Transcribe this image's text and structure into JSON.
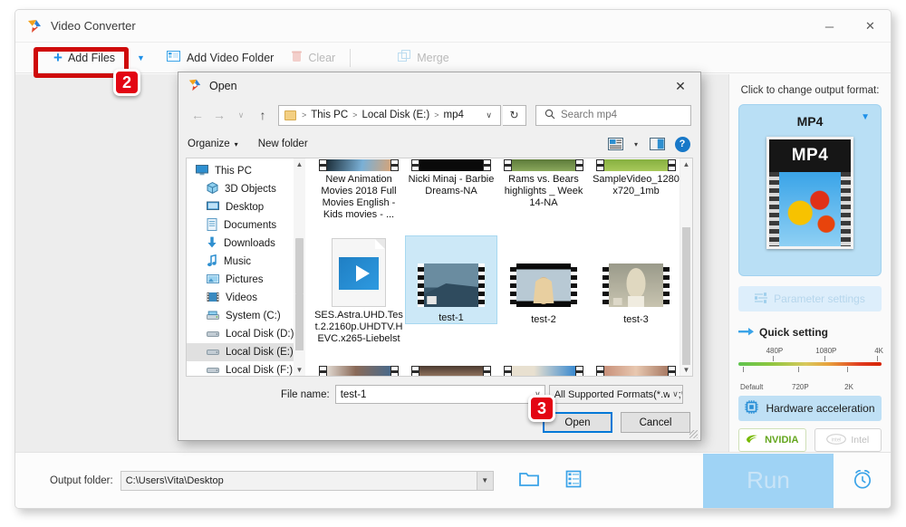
{
  "app": {
    "title": "Video Converter",
    "window_buttons": [
      {
        "name": "minimize",
        "glyph": "─"
      },
      {
        "name": "close",
        "glyph": "✕"
      }
    ],
    "toolbar": {
      "add_files": "Add Files",
      "add_files_caret": "▼",
      "add_video_folder": "Add Video Folder",
      "clear": "Clear",
      "merge": "Merge"
    },
    "bottom": {
      "output_label": "Output folder:",
      "output_path": "C:\\Users\\Vita\\Desktop",
      "run": "Run",
      "dropdown_caret": "▼"
    }
  },
  "right_panel": {
    "hint": "Click to change output format:",
    "format_name": "MP4",
    "format_caret": "▼",
    "thumb_label": "MP4",
    "parameter_settings": "Parameter settings",
    "quick_setting": "Quick setting",
    "slider_top_ticks": [
      "480P",
      "1080P",
      "4K"
    ],
    "slider_bottom_ticks": [
      "Default",
      "720P",
      "2K"
    ],
    "hardware_acceleration": "Hardware acceleration",
    "gpu_nvidia": "NVIDIA",
    "gpu_intel": "Intel"
  },
  "open_dialog": {
    "title": "Open",
    "close_glyph": "✕",
    "nav": {
      "back": "←",
      "forward": "→",
      "recent": "∨",
      "up": "↑",
      "refresh": "↻",
      "caret": "∨"
    },
    "breadcrumb": [
      "This PC",
      "Local Disk (E:)",
      "mp4"
    ],
    "breadcrumb_sep": ">",
    "search_placeholder": "Search mp4",
    "commands": {
      "organize": "Organize",
      "organize_caret": "▾",
      "new_folder": "New folder",
      "help": "?"
    },
    "nav_pane": [
      {
        "label": "This PC",
        "icon": "monitor-icon",
        "indent": false,
        "selected": false
      },
      {
        "label": "3D Objects",
        "icon": "cube-icon",
        "indent": true,
        "selected": false
      },
      {
        "label": "Desktop",
        "icon": "desktop-icon",
        "indent": true,
        "selected": false
      },
      {
        "label": "Documents",
        "icon": "documents-icon",
        "indent": true,
        "selected": false
      },
      {
        "label": "Downloads",
        "icon": "download-icon",
        "indent": true,
        "selected": false
      },
      {
        "label": "Music",
        "icon": "music-icon",
        "indent": true,
        "selected": false
      },
      {
        "label": "Pictures",
        "icon": "pictures-icon",
        "indent": true,
        "selected": false
      },
      {
        "label": "Videos",
        "icon": "videos-icon",
        "indent": true,
        "selected": false
      },
      {
        "label": "System (C:)",
        "icon": "drive-icon",
        "indent": true,
        "selected": false
      },
      {
        "label": "Local Disk (D:)",
        "icon": "drive-icon",
        "indent": true,
        "selected": false
      },
      {
        "label": "Local Disk (E:)",
        "icon": "drive-icon",
        "indent": true,
        "selected": true
      },
      {
        "label": "Local Disk (F:)",
        "icon": "drive-icon",
        "indent": true,
        "selected": false
      }
    ],
    "files": {
      "row1": [
        {
          "name": "New Animation Movies 2018 Full Movies English - Kids movies - ...",
          "selected": false
        },
        {
          "name": "Nicki Minaj - Barbie Dreams-NA",
          "selected": false
        },
        {
          "name": "Rams vs. Bears highlights _ Week 14-NA",
          "selected": false
        },
        {
          "name": "SampleVideo_1280x720_1mb",
          "selected": false
        }
      ],
      "row2": [
        {
          "name": "SES.Astra.UHD.Test.2.2160p.UHDTV.HEVC.x265-Liebelst",
          "selected": false
        },
        {
          "name": "test-1",
          "selected": true
        },
        {
          "name": "test-2",
          "selected": false
        },
        {
          "name": "test-3",
          "selected": false
        }
      ]
    },
    "footer": {
      "file_name_label": "File name:",
      "file_name_value": "test-1",
      "file_type_value": "All Supported Formats(*.wtv;*.c",
      "open_button": "Open",
      "cancel_button": "Cancel"
    }
  },
  "annotations": {
    "step2": "2",
    "step3": "3",
    "highlight_color": "#cf0a0a",
    "badge_color": "#e30613"
  }
}
